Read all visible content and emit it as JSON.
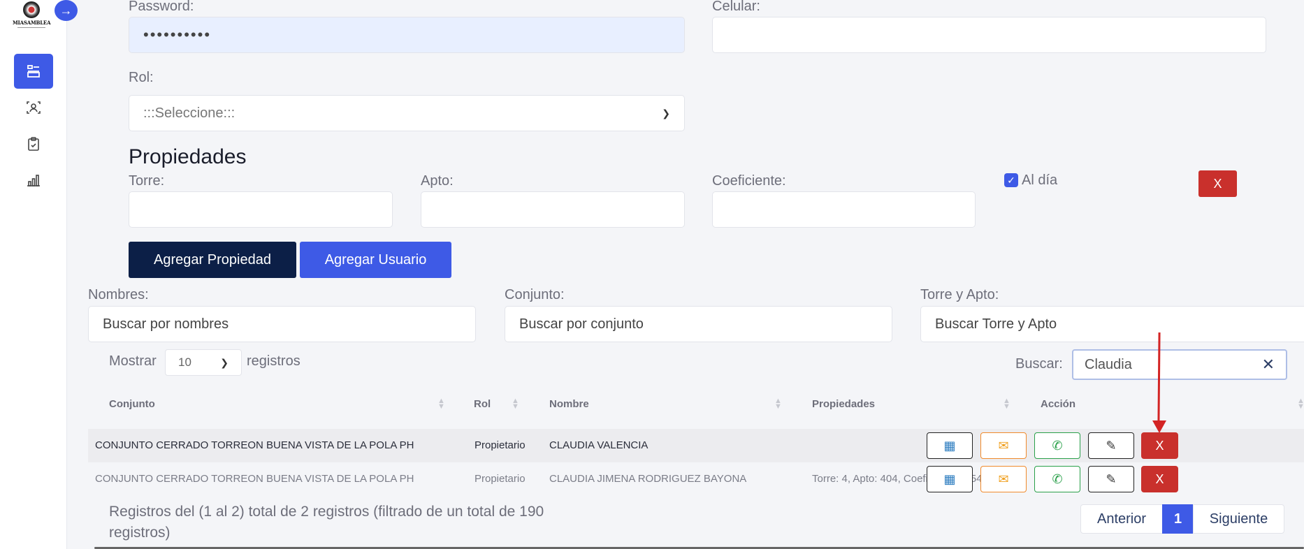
{
  "sidebar": {
    "logo_text": "MIASAMBLEA",
    "items": [
      {
        "icon": "form-icon",
        "active": true
      },
      {
        "icon": "user-id-icon",
        "active": false
      },
      {
        "icon": "clipboard-icon",
        "active": false
      },
      {
        "icon": "bar-chart-icon",
        "active": false
      }
    ]
  },
  "form": {
    "password_label": "Password:",
    "password_value": "••••••••••",
    "celular_label": "Celular:",
    "celular_value": "",
    "rol_label": "Rol:",
    "rol_selected": ":::Seleccione:::",
    "propiedades_title": "Propiedades",
    "torre_label": "Torre:",
    "apto_label": "Apto:",
    "coeficiente_label": "Coeficiente:",
    "al_dia_label": "Al día",
    "remove_label": "X",
    "add_property_label": "Agregar Propiedad",
    "add_user_label": "Agregar Usuario"
  },
  "filters": {
    "nombres_label": "Nombres:",
    "nombres_placeholder": "Buscar por nombres",
    "conjunto_label": "Conjunto:",
    "conjunto_placeholder": "Buscar por conjunto",
    "torre_apto_label": "Torre y Apto:",
    "torre_apto_placeholder": "Buscar Torre y Apto"
  },
  "table": {
    "show_prefix": "Mostrar",
    "show_value": "10",
    "show_suffix": "registros",
    "search_label": "Buscar:",
    "search_value": "Claudia",
    "columns": [
      "Conjunto",
      "Rol",
      "Nombre",
      "Propiedades",
      "Acción"
    ],
    "rows": [
      {
        "conjunto": "CONJUNTO CERRADO TORREON BUENA VISTA DE LA POLA PH",
        "rol": "Propietario",
        "nombre": "CLAUDIA VALENCIA",
        "propiedades": ""
      },
      {
        "conjunto": "CONJUNTO CERRADO TORREON BUENA VISTA DE LA POLA PH",
        "rol": "Propietario",
        "nombre": "CLAUDIA JIMENA RODRIGUEZ BAYONA",
        "propiedades": "Torre: 4, Apto: 404, Coeficiente: 0.543"
      }
    ],
    "delete_label": "X",
    "footer": "Registros del (1 al 2) total de 2 registros (filtrado de un total de 190 registros)",
    "pager": {
      "prev": "Anterior",
      "current": "1",
      "next": "Siguiente"
    }
  },
  "colors": {
    "accent": "#3e5ae6",
    "dark": "#0c1f47",
    "danger": "#c9302c",
    "whatsapp": "#2aa04a",
    "mail": "#f08a2c"
  }
}
